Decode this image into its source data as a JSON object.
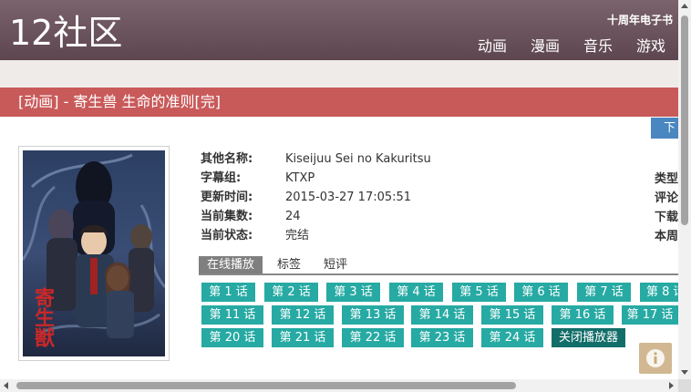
{
  "site": {
    "logo": "12社区",
    "top_link": "十周年电子书",
    "nav": [
      "动画",
      "漫画",
      "音乐",
      "游戏"
    ]
  },
  "page": {
    "title": "[动画] - 寄生兽 生命的准则[完]",
    "download_tab": "下"
  },
  "info": {
    "rows": [
      {
        "label": "其他名称:",
        "value": "Kiseijuu Sei no Kakuritsu"
      },
      {
        "label": "字幕组:",
        "value": "KTXP"
      },
      {
        "label": "更新时间:",
        "value": "2015-03-27 17:05:51"
      },
      {
        "label": "当前集数:",
        "value": "24"
      },
      {
        "label": "当前状态:",
        "value": "完结"
      }
    ],
    "side_labels": [
      "类型",
      "评论",
      "下载",
      "本周"
    ]
  },
  "tabs": [
    "在线播放",
    "标签",
    "短评"
  ],
  "episodes": {
    "row1": [
      "第 1 话",
      "第 2 话",
      "第 3 话",
      "第 4 话",
      "第 5 话",
      "第 6 话",
      "第 7 话",
      "第 8 话"
    ],
    "row2": [
      "第 11 话",
      "第 12 话",
      "第 13 话",
      "第 14 话",
      "第 15 话",
      "第 16 话",
      "第 17 话"
    ],
    "row3": [
      "第 20 话",
      "第 21 话",
      "第 22 话",
      "第 23 话",
      "第 24 话"
    ],
    "close_player": "关闭播放器"
  },
  "poster": {
    "caption": "寄生獣"
  },
  "icons": {
    "info_badge": "info-icon"
  },
  "colors": {
    "header": "#6a535c",
    "title_bar": "#c95a5a",
    "episode": "#26aaa3",
    "close_button": "#136e6a",
    "download_tab": "#4a86c0"
  }
}
